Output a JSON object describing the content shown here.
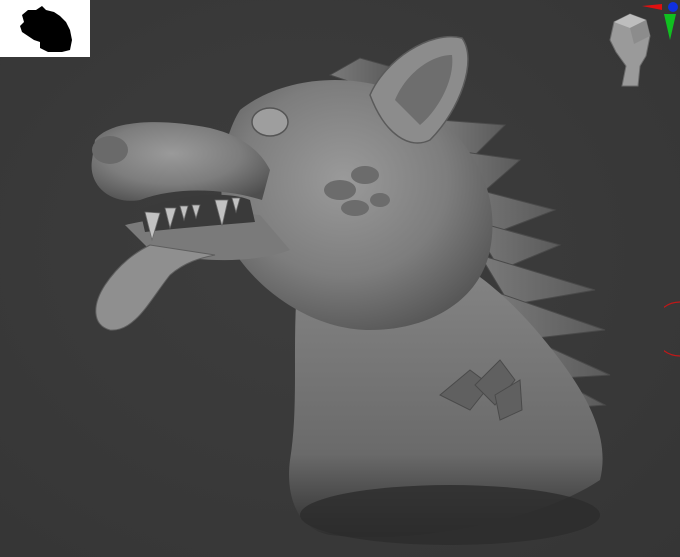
{
  "viewport": {
    "background_color": "#3a3a3a",
    "model": "sculpted-wolf-head-bust",
    "model_color": "#8a8a8a"
  },
  "thumbnail": {
    "icon": "wolf-silhouette-icon",
    "background_color": "#ffffff",
    "silhouette_color": "#000000"
  },
  "navigation": {
    "icon": "head-orientation-icon",
    "axis_colors": {
      "x": "#e01010",
      "y": "#10c020",
      "z": "#1030e0"
    }
  },
  "gizmo": {
    "icon": "rotation-ring-icon",
    "color": "#c01818"
  }
}
